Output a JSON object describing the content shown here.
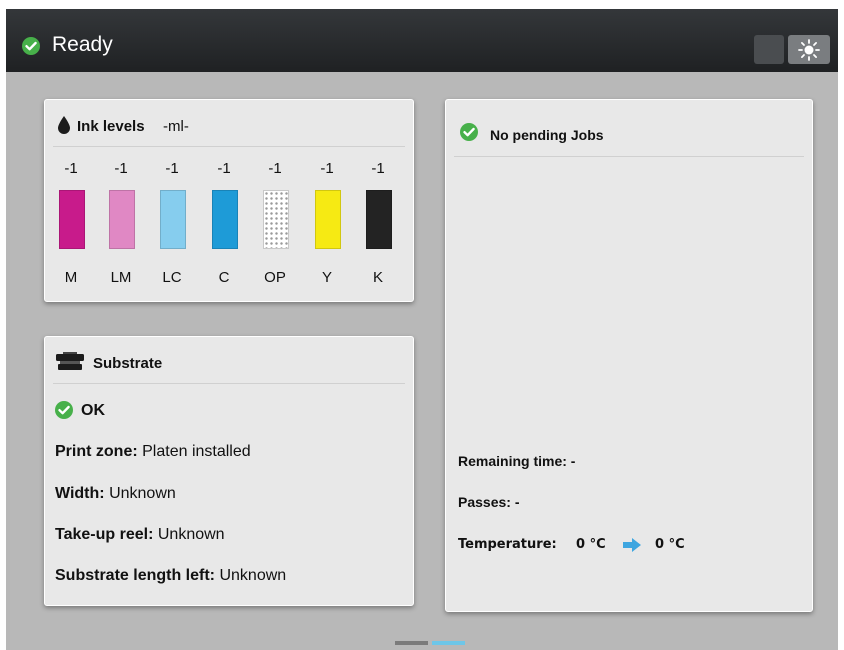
{
  "topbar": {
    "status": "Ready",
    "status_icon": "check-circle-icon",
    "brightness_icon": "brightness-icon"
  },
  "ink_panel": {
    "title": "Ink levels",
    "unit": "-ml-",
    "icon": "ink-drop-icon",
    "inks": [
      {
        "name": "M",
        "value": "-1",
        "color": "#c81b8b"
      },
      {
        "name": "LM",
        "value": "-1",
        "color": "#e088c4"
      },
      {
        "name": "LC",
        "value": "-1",
        "color": "#86cdee"
      },
      {
        "name": "C",
        "value": "-1",
        "color": "#1e9bd7"
      },
      {
        "name": "OP",
        "value": "-1",
        "color": "#ffffff"
      },
      {
        "name": "Y",
        "value": "-1",
        "color": "#f6ea13"
      },
      {
        "name": "K",
        "value": "-1",
        "color": "#232323"
      }
    ]
  },
  "substrate_panel": {
    "title": "Substrate",
    "icon": "substrate-icon",
    "status": "OK",
    "print_zone_label": "Print zone:",
    "print_zone_value": "Platen installed",
    "width_label": "Width:",
    "width_value": "Unknown",
    "takeup_label": "Take-up reel:",
    "takeup_value": "Unknown",
    "length_label": "Substrate length left:",
    "length_value": "Unknown"
  },
  "jobs_panel": {
    "title": "No pending Jobs",
    "remaining_time": "Remaining time: -",
    "passes": "Passes: -",
    "temperature_label": "Temperature:",
    "temperature_current": "0 °C",
    "temperature_target": "0 °C"
  },
  "colors": {
    "accent_green": "#47b04a",
    "accent_blue": "#6ec6e8"
  }
}
